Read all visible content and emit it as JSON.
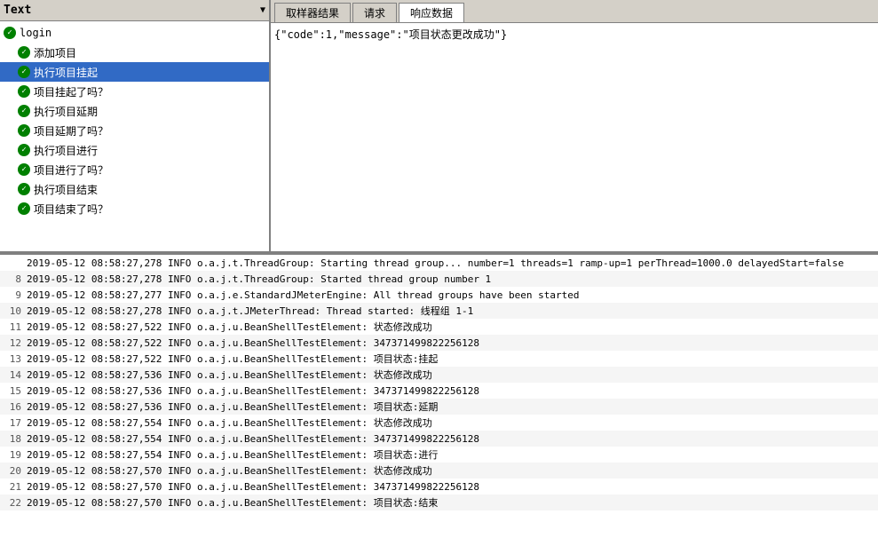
{
  "treePanel": {
    "header": "Text",
    "items": [
      {
        "id": "login",
        "label": "login",
        "level": 0,
        "selected": false
      },
      {
        "id": "add-project",
        "label": "添加项目",
        "level": 1,
        "selected": false
      },
      {
        "id": "suspend-project",
        "label": "执行项目挂起",
        "level": 1,
        "selected": true
      },
      {
        "id": "is-suspended",
        "label": "项目挂起了吗？",
        "level": 1,
        "selected": false
      },
      {
        "id": "delay-project",
        "label": "执行项目延期",
        "level": 1,
        "selected": false
      },
      {
        "id": "is-delayed",
        "label": "项目延期了吗？",
        "level": 1,
        "selected": false
      },
      {
        "id": "proceed-project",
        "label": "执行项目进行",
        "level": 1,
        "selected": false
      },
      {
        "id": "is-proceeding",
        "label": "项目进行了吗？",
        "level": 1,
        "selected": false
      },
      {
        "id": "end-project",
        "label": "执行项目结束",
        "level": 1,
        "selected": false
      },
      {
        "id": "is-ended",
        "label": "项目结束了吗？",
        "level": 1,
        "selected": false
      }
    ]
  },
  "tabs": [
    {
      "id": "sampler-result",
      "label": "取样器结果",
      "active": false
    },
    {
      "id": "request",
      "label": "请求",
      "active": false
    },
    {
      "id": "response-data",
      "label": "响应数据",
      "active": true
    }
  ],
  "responseContent": "{\"code\":1,\"message\":\"项目状态更改成功\"}",
  "logLines": [
    {
      "num": "",
      "text": "2019-05-12 08:58:27,278 INFO o.a.j.t.ThreadGroup: Starting thread group... number=1 threads=1 ramp-up=1 perThread=1000.0 delayedStart=false"
    },
    {
      "num": "8",
      "text": "2019-05-12 08:58:27,278 INFO o.a.j.t.ThreadGroup: Started thread group number 1"
    },
    {
      "num": "9",
      "text": "2019-05-12 08:58:27,277 INFO o.a.j.e.StandardJMeterEngine: All thread groups have been started"
    },
    {
      "num": "10",
      "text": "2019-05-12 08:58:27,278 INFO o.a.j.t.JMeterThread: Thread started: 线程组 1-1"
    },
    {
      "num": "11",
      "text": "2019-05-12 08:58:27,522 INFO o.a.j.u.BeanShellTestElement: 状态修改成功"
    },
    {
      "num": "12",
      "text": "2019-05-12 08:58:27,522 INFO o.a.j.u.BeanShellTestElement: 347371499822256128"
    },
    {
      "num": "13",
      "text": "2019-05-12 08:58:27,522 INFO o.a.j.u.BeanShellTestElement: 项目状态:挂起"
    },
    {
      "num": "14",
      "text": "2019-05-12 08:58:27,536 INFO o.a.j.u.BeanShellTestElement: 状态修改成功"
    },
    {
      "num": "15",
      "text": "2019-05-12 08:58:27,536 INFO o.a.j.u.BeanShellTestElement: 347371499822256128"
    },
    {
      "num": "16",
      "text": "2019-05-12 08:58:27,536 INFO o.a.j.u.BeanShellTestElement: 项目状态:延期"
    },
    {
      "num": "17",
      "text": "2019-05-12 08:58:27,554 INFO o.a.j.u.BeanShellTestElement: 状态修改成功"
    },
    {
      "num": "18",
      "text": "2019-05-12 08:58:27,554 INFO o.a.j.u.BeanShellTestElement: 347371499822256128"
    },
    {
      "num": "19",
      "text": "2019-05-12 08:58:27,554 INFO o.a.j.u.BeanShellTestElement: 项目状态:进行"
    },
    {
      "num": "20",
      "text": "2019-05-12 08:58:27,570 INFO o.a.j.u.BeanShellTestElement: 状态修改成功"
    },
    {
      "num": "21",
      "text": "2019-05-12 08:58:27,570 INFO o.a.j.u.BeanShellTestElement: 347371499822256128"
    },
    {
      "num": "22",
      "text": "2019-05-12 08:58:27,570 INFO o.a.j.u.BeanShellTestElement: 项目状态:结束"
    }
  ]
}
